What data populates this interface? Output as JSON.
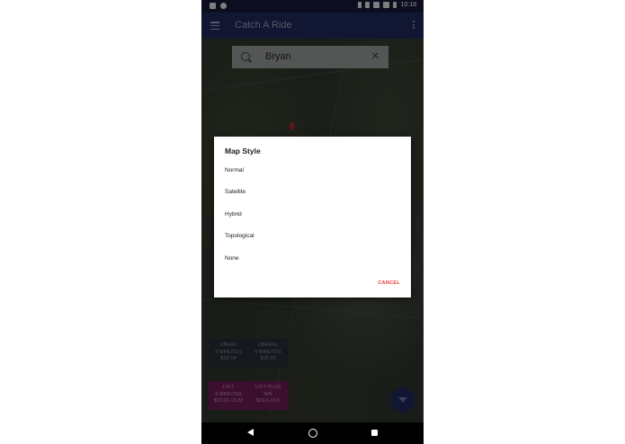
{
  "status_bar": {
    "time": "10:18"
  },
  "app_bar": {
    "title": "Catch A Ride"
  },
  "search": {
    "value": "Bryan"
  },
  "dialog": {
    "title": "Map Style",
    "options": [
      "Normal",
      "Satellite",
      "Hybrid",
      "Topological",
      "None"
    ],
    "cancel_label": "CANCEL"
  },
  "uber_card": [
    {
      "name": "UBERX",
      "eta": "5 MINUTES",
      "price": "$10-14"
    },
    {
      "name": "UBERXL",
      "eta": "6 MINUTES",
      "price": "$15-20"
    }
  ],
  "lyft_card": [
    {
      "name": "LYFT",
      "eta": "5 MINUTES",
      "price": "$13.02-13.02"
    },
    {
      "name": "LYFT PLUS",
      "eta": "N/A",
      "price": "$19.5-19.5"
    }
  ],
  "colors": {
    "app_bar": "#1f2a5c",
    "dialog_action": "#e53935",
    "lyft": "#6e1a56",
    "uber": "#2a2c38"
  },
  "icons": [
    "menu-icon",
    "more-vert-icon",
    "search-icon",
    "clear-icon",
    "map-pin-icon",
    "expand-icon",
    "back-icon",
    "home-icon",
    "recents-icon"
  ]
}
